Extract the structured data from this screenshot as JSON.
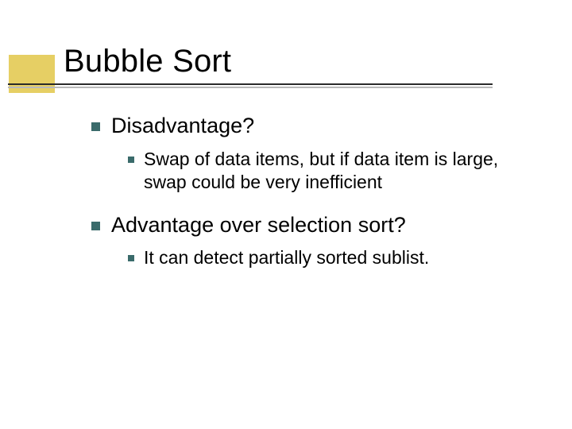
{
  "colors": {
    "accent_block": "#e6cf64",
    "bullet": "#3a6b6b",
    "rule_dark": "#2a2a2a",
    "rule_light": "#b9b9b9"
  },
  "title": "Bubble Sort",
  "items": [
    {
      "label": "Disadvantage?",
      "sub": [
        "Swap of data items, but if data item is large, swap could be very inefficient"
      ]
    },
    {
      "label": "Advantage over selection sort?",
      "sub": [
        "It can detect partially sorted sublist."
      ]
    }
  ]
}
